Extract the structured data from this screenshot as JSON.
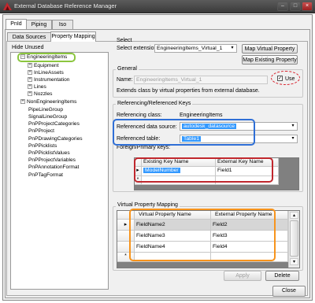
{
  "window": {
    "title": "External Database Reference Manager"
  },
  "top_tabs": [
    "PnId",
    "Piping",
    "Iso"
  ],
  "sub_tabs": [
    "Data Sources",
    "Property Mapping"
  ],
  "left": {
    "hide_unused": "Hide Unused",
    "tree": [
      {
        "label": "EngineeringItems",
        "expander": "−"
      },
      {
        "label": "Equipment",
        "expander": "+"
      },
      {
        "label": "InLineAssets",
        "expander": "+"
      },
      {
        "label": "Instrumentation",
        "expander": "+"
      },
      {
        "label": "Lines",
        "expander": "+"
      },
      {
        "label": "Nozzles",
        "expander": "+"
      },
      {
        "label": "NonEngineeringItems",
        "expander": "+"
      },
      {
        "label": "PipeLineGroup",
        "expander": ""
      },
      {
        "label": "SignalLineGroup",
        "expander": ""
      },
      {
        "label": "PnPProjectCategories",
        "expander": ""
      },
      {
        "label": "PnPProject",
        "expander": ""
      },
      {
        "label": "PnPDrawingCategories",
        "expander": ""
      },
      {
        "label": "PnPPicklists",
        "expander": ""
      },
      {
        "label": "PnPPicklistValues",
        "expander": ""
      },
      {
        "label": "PnPProjectVariables",
        "expander": ""
      },
      {
        "label": "PnPAnnotationFormat",
        "expander": ""
      },
      {
        "label": "PnPTagFormat",
        "expander": ""
      }
    ]
  },
  "select": {
    "title": "Select",
    "extension_label": "Select extension",
    "extension_value": "EngineeringItems_Virtual_1",
    "map_virtual_button": "Map Virtual Property",
    "map_existing_button": "Map Existing Property"
  },
  "general": {
    "title": "General",
    "name_label": "Name:",
    "name_value": "EngineeringItems_Virtual_1",
    "use_label": "Use",
    "use_checked": "✓",
    "extends_text": "Extends class by virtual properties from external database."
  },
  "keys": {
    "title": "Referencing/Referenced Keys",
    "ref_class_label": "Referencing class:",
    "ref_class_value": "EngineeringItems",
    "data_source_label": "Referenced data source:",
    "data_source_value": "autodesk_datasource",
    "table_label": "Referenced table:",
    "table_value": "Table1",
    "foreign_label": "Foreign/Primary keys:",
    "headers": [
      "Existing Key Name",
      "External Key Name"
    ],
    "rows": [
      [
        "ModelNumber",
        "Field1"
      ]
    ],
    "new_row_marker": "*"
  },
  "vpm": {
    "title": "Virtual Property Mapping",
    "headers": [
      "Virtual Property Name",
      "External Property Name"
    ],
    "rows": [
      [
        "FieldName2",
        "Field2"
      ],
      [
        "FieldName3",
        "Field3"
      ],
      [
        "FieldName4",
        "Field4"
      ]
    ],
    "new_row_marker": "*",
    "current_row_marker": "▸"
  },
  "buttons": {
    "apply": "Apply",
    "delete": "Delete",
    "close": "Close"
  },
  "colors": {
    "annotation_green": "#8cc63f",
    "annotation_blue": "#2f6fd6",
    "annotation_red": "#c0272d",
    "annotation_orange": "#f7941d",
    "annotation_dashed_red": "#d9232e",
    "selection": "#3399ff"
  }
}
